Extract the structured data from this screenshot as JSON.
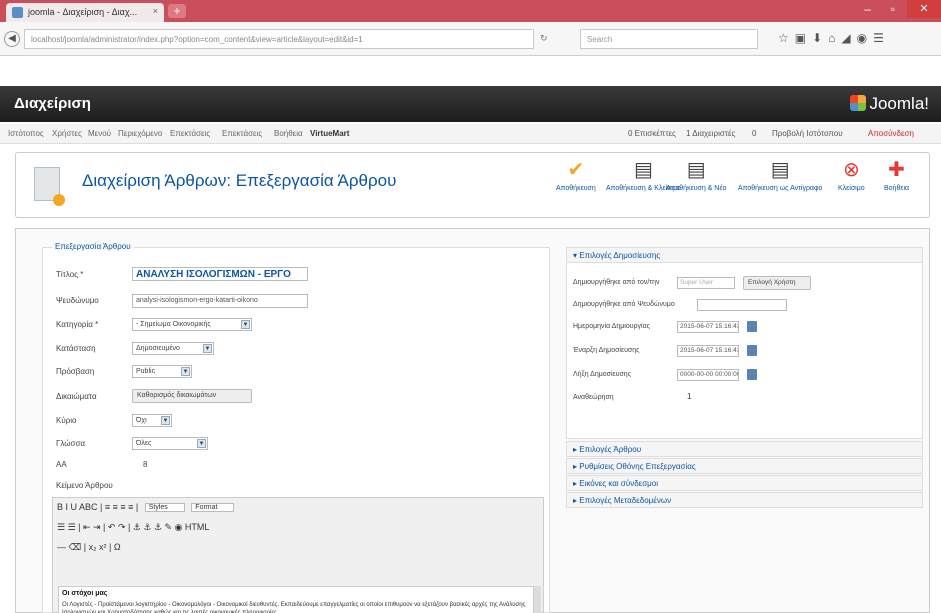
{
  "browser": {
    "tab_title": "joomla - Διαχείριση - Διαχ...",
    "tab_close": "×",
    "new_tab": "+",
    "url": "localhost/joomla/administrator/index.php?option=com_content&view=article&layout=edit&id=1",
    "reload": "↻",
    "search_placeholder": "Search"
  },
  "header": {
    "title": "Διαχείριση",
    "logo": "Joomla!"
  },
  "menubar": {
    "items": [
      "Ιστότοπος",
      "Χρήστες",
      "Μενού",
      "Περιεχόμενο",
      "Επεκτάσεις",
      "Επεκτάσεις",
      "Βοήθεια",
      "VirtueMart"
    ],
    "right": [
      "0 Επισκέπτες",
      "1 Διαχειριστές",
      "0",
      "Προβολή Ιστότοπου",
      "Αποσύνδεση"
    ]
  },
  "page": {
    "title": "Διαχείριση Άρθρων: Επεξεργασία Άρθρου"
  },
  "toolbar": {
    "save": "Αποθήκευση",
    "save_close": "Αποθήκευση & Κλείσιμο",
    "save_new": "Αποθήκευση & Νέο",
    "save_copy": "Αποθήκευση ως Αντίγραφο",
    "close": "Κλείσιμο",
    "help": "Βοήθεια"
  },
  "form": {
    "legend": "Επεξεργασία Άρθρου",
    "labels": {
      "title": "Τίτλος *",
      "alias": "Ψευδώνυμο",
      "category": "Κατηγορία *",
      "state": "Κατάσταση",
      "access": "Πρόσβαση",
      "permissions": "Δικαιώματα",
      "featured": "Κύριο",
      "language": "Γλώσσα",
      "id": "ΑΑ",
      "text": "Κείμενο Άρθρου"
    },
    "values": {
      "title": "ΑΝΑΛΥΣΗ ΙΣΟΛΟΓΙΣΜΩΝ - ΕΡΓΟ",
      "alias": "analysi-isologismon-ergo-katarti-oikono",
      "category": "- Σημείωμα Οικονομικής",
      "state": "Δημοσιευμένο",
      "access": "Public",
      "permissions_button": "Καθορισμός δικαιωμάτων",
      "featured": "Όχι",
      "language": "Όλες",
      "id": "8"
    }
  },
  "editor": {
    "row1": "B  I  U  ABC  |  ≡  ≡  ≡  ≡  |",
    "styles": "Styles",
    "format": "Format",
    "row2": "☰  ☰  |  ⇤  ⇥  |  ↶  ↷  |  ⚓  ⚓  ⚓  ✎  ◉  HTML",
    "row3": "—  ⌫  |  x₂  x²  |  Ω",
    "content_heading": "Οι στόχοι μας",
    "content_text": "Οι Λογιστές - Προϊστάμενοι λογιστηρίου - Οικονομολόγοι - Οικονομικοί διευθυντές. Εκπαιδεύουμε επαγγελματίες οι οποίοι επιθυμούν να εξετάζουν βασικές αρχές της Ανάλυσης Ισολογισμών και Χρηματοδότησης καθώς και τις λοιπές οικονομικές πληροφορίες."
  },
  "right_panel": {
    "publishing_header": "Επιλογές Δημοσίευσης",
    "labels": {
      "created_by": "Δημιουργήθηκε από τον/την",
      "created_by_alias": "Δημιουργήθηκε από Ψευδώνυμο",
      "created_date": "Ημερομηνία Δημιουργίας",
      "start_publishing": "Έναρξη Δημοσίευσης",
      "finish_publishing": "Λήξη Δημοσίευσης",
      "revision": "Αναθεώρηση"
    },
    "values": {
      "created_by_placeholder": "Super User",
      "select_user_button": "Επιλογή Χρήστη",
      "created_date": "2015-06-07 15:16:43",
      "start_publishing": "2015-06-07 15:16:43",
      "finish_publishing": "0000-00-00 00:00:00",
      "revision": "1"
    },
    "collapsed": [
      "Επιλογές Άρθρου",
      "Ρυθμίσεις Οθόνης Επεξεργασίας",
      "Εικόνες και σύνδεσμοι",
      "Επιλογές Μεταδεδομένων"
    ]
  },
  "colors": {
    "brand_link": "#0b55a3",
    "titlebar": "#c94f5c",
    "header_dark": "#2a2a2a",
    "save_check": "#f5a623",
    "close_red": "#e53935"
  }
}
